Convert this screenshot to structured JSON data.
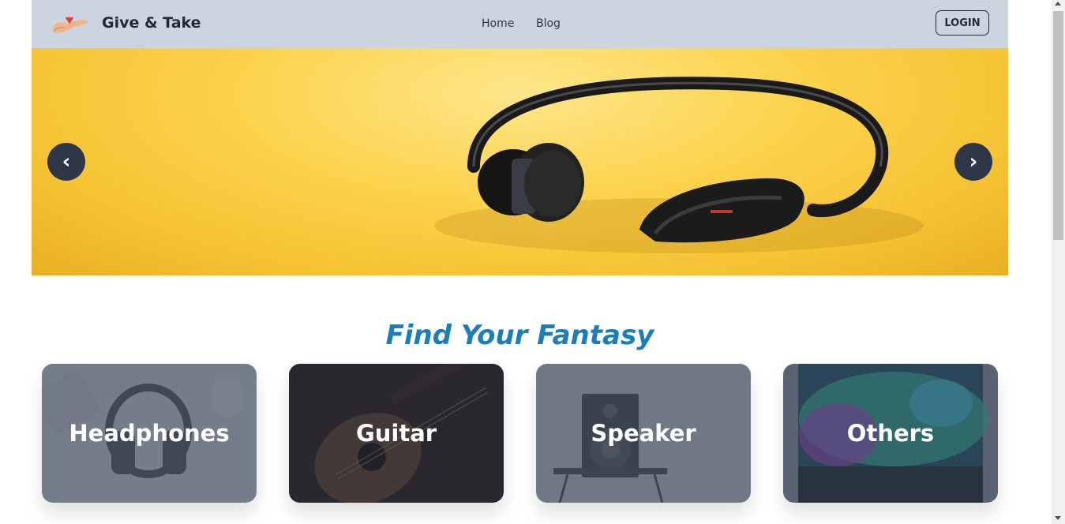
{
  "navbar": {
    "brand_name": "Give & Take",
    "links": [
      {
        "label": "Home"
      },
      {
        "label": "Blog"
      }
    ],
    "login_label": "LOGIN"
  },
  "hero": {
    "prev_label": "‹",
    "next_label": "›",
    "background_color": "#fcd34d"
  },
  "section": {
    "title": "Find Your Fantasy"
  },
  "categories": [
    {
      "label": "Headphones"
    },
    {
      "label": "Guitar"
    },
    {
      "label": "Speaker"
    },
    {
      "label": "Others"
    }
  ],
  "colors": {
    "navbar_bg": "#cbd5e0",
    "accent_title": "#1a7fb8",
    "carousel_button": "#2d3748"
  }
}
